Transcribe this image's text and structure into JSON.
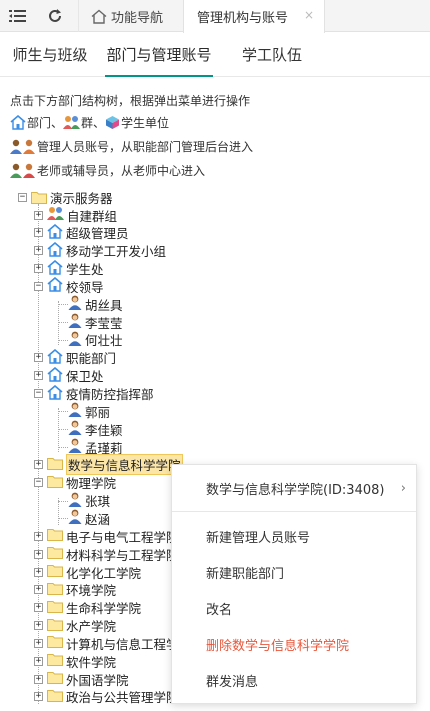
{
  "topbar": {
    "home_tab_label": "功能导航",
    "active_tab_label": "管理机构与账号",
    "close_glyph": "×"
  },
  "subtabs": [
    "师生与班级",
    "部门与管理账号",
    "学工队伍"
  ],
  "hints": {
    "line1": "点击下方部门结构树，根据弹出菜单进行操作",
    "line2_a": "部门、",
    "line2_b": "群、",
    "line2_c": "学生单位",
    "line3": "管理人员账号，从职能部门管理后台进入",
    "line4": "老师或辅导员，从老师中心进入"
  },
  "tree": {
    "root": "演示服务器",
    "nodes": [
      {
        "label": "自建群组",
        "icon": "group-icon",
        "toggle": "+"
      },
      {
        "label": "超级管理员",
        "icon": "house-icon",
        "toggle": "+"
      },
      {
        "label": "移动学工开发小组",
        "icon": "house-icon",
        "toggle": "+"
      },
      {
        "label": "学生处",
        "icon": "house-icon",
        "toggle": "+"
      },
      {
        "label": "校领导",
        "icon": "house-icon",
        "toggle": "-"
      },
      {
        "label": "胡丝具",
        "icon": "person-icon",
        "child": true
      },
      {
        "label": "李莹莹",
        "icon": "person-icon",
        "child": true
      },
      {
        "label": "何壮壮",
        "icon": "person-icon",
        "child": true
      },
      {
        "label": "职能部门",
        "icon": "house-icon",
        "toggle": "+"
      },
      {
        "label": "保卫处",
        "icon": "house-icon",
        "toggle": "+"
      },
      {
        "label": "疫情防控指挥部",
        "icon": "house-icon",
        "toggle": "-"
      },
      {
        "label": "郭丽",
        "icon": "person-icon",
        "child": true
      },
      {
        "label": "李佳颖",
        "icon": "person-icon",
        "child": true
      },
      {
        "label": "孟瑾莉",
        "icon": "person-icon",
        "child": true
      },
      {
        "label": "数学与信息科学学院",
        "icon": "folder-icon",
        "toggle": "+",
        "selected": true
      },
      {
        "label": "物理学院",
        "icon": "folder-icon",
        "toggle": "-"
      },
      {
        "label": "张琪",
        "icon": "person-icon",
        "child": true
      },
      {
        "label": "赵涵",
        "icon": "person-icon",
        "child": true
      },
      {
        "label": "电子与电气工程学院",
        "icon": "folder-icon",
        "toggle": "+"
      },
      {
        "label": "材料科学与工程学院",
        "icon": "folder-icon",
        "toggle": "+"
      },
      {
        "label": "化学化工学院",
        "icon": "folder-icon",
        "toggle": "+"
      },
      {
        "label": "环境学院",
        "icon": "folder-icon",
        "toggle": "+"
      },
      {
        "label": "生命科学学院",
        "icon": "folder-icon",
        "toggle": "+"
      },
      {
        "label": "水产学院",
        "icon": "folder-icon",
        "toggle": "+"
      },
      {
        "label": "计算机与信息工程学院",
        "icon": "folder-icon",
        "toggle": "+"
      },
      {
        "label": "软件学院",
        "icon": "folder-icon",
        "toggle": "+"
      },
      {
        "label": "外国语学院",
        "icon": "folder-icon",
        "toggle": "+"
      },
      {
        "label": "政治与公共管理学院",
        "icon": "folder-icon",
        "toggle": "+"
      }
    ]
  },
  "context_menu": {
    "header": "数学与信息科学学院(ID:3408)",
    "header_chevron": "›",
    "items": [
      "新建管理人员账号",
      "新建职能部门",
      "改名",
      "删除数学与信息科学学院",
      "群发消息"
    ],
    "danger_color": "#e8573b"
  },
  "colors": {
    "accent": "#009688",
    "selected_bg": "#fbe6a8"
  }
}
